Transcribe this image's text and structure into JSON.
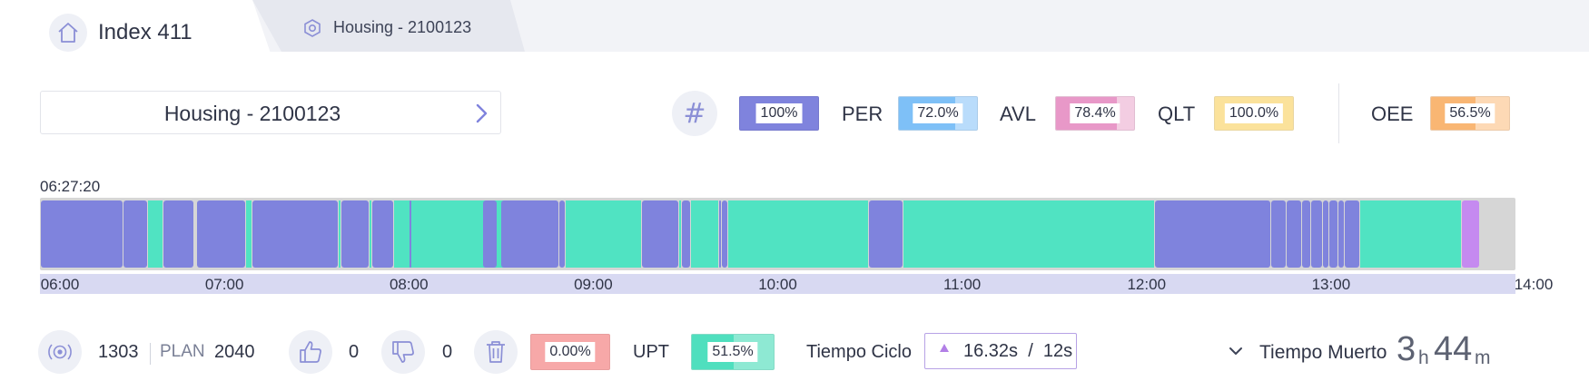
{
  "tabs": {
    "active_title": "Index 411",
    "inactive_title": "Housing - 2100123"
  },
  "selector": {
    "label": "Housing - 2100123"
  },
  "kpis": {
    "overall": {
      "value": "100%",
      "fraction": 1.0
    },
    "per": {
      "label": "PER",
      "value": "72.0%",
      "fraction": 0.72
    },
    "avl": {
      "label": "AVL",
      "value": "78.4%",
      "fraction": 0.784
    },
    "qlt": {
      "label": "QLT",
      "value": "100.0%",
      "fraction": 1.0
    },
    "oee": {
      "label": "OEE",
      "value": "56.5%",
      "fraction": 0.565
    }
  },
  "timeline": {
    "start_time": "06:27:20",
    "ticks": [
      "06:00",
      "07:00",
      "08:00",
      "09:00",
      "10:00",
      "11:00",
      "12:00",
      "13:00",
      "14:00"
    ],
    "range_hours": [
      6.0,
      14.0
    ],
    "segments": [
      {
        "from": "06:00",
        "to": "06:27",
        "state": "stopped"
      },
      {
        "from": "06:27",
        "to": "06:35",
        "state": "stopped"
      },
      {
        "from": "06:35",
        "to": "06:40",
        "state": "gap"
      },
      {
        "from": "06:40",
        "to": "06:50",
        "state": "stopped"
      },
      {
        "from": "06:51",
        "to": "07:07",
        "state": "stopped"
      },
      {
        "from": "07:07",
        "to": "07:09",
        "state": "running"
      },
      {
        "from": "07:09",
        "to": "07:37",
        "state": "stopped"
      },
      {
        "from": "07:37",
        "to": "07:38",
        "state": "running"
      },
      {
        "from": "07:38",
        "to": "07:47",
        "state": "stopped"
      },
      {
        "from": "07:47",
        "to": "07:48",
        "state": "running"
      },
      {
        "from": "07:48",
        "to": "07:55",
        "state": "stopped"
      },
      {
        "from": "07:55",
        "to": "08:40",
        "state": "running"
      },
      {
        "from": "08:00",
        "to": "08:01",
        "state": "stopped"
      },
      {
        "from": "08:24",
        "to": "08:29",
        "state": "stopped"
      },
      {
        "from": "08:29",
        "to": "08:30",
        "state": "running"
      },
      {
        "from": "08:30",
        "to": "08:49",
        "state": "stopped"
      },
      {
        "from": "08:49",
        "to": "08:51",
        "state": "stopped"
      },
      {
        "from": "08:51",
        "to": "09:16",
        "state": "running"
      },
      {
        "from": "09:16",
        "to": "09:28",
        "state": "stopped"
      },
      {
        "from": "09:28",
        "to": "09:29",
        "state": "running"
      },
      {
        "from": "09:29",
        "to": "09:32",
        "state": "stopped"
      },
      {
        "from": "09:32",
        "to": "09:41",
        "state": "running"
      },
      {
        "from": "09:41",
        "to": "09:42",
        "state": "stopped"
      },
      {
        "from": "09:42",
        "to": "09:44",
        "state": "stopped"
      },
      {
        "from": "09:44",
        "to": "10:30",
        "state": "running"
      },
      {
        "from": "10:30",
        "to": "10:41",
        "state": "stopped"
      },
      {
        "from": "10:41",
        "to": "12:03",
        "state": "running"
      },
      {
        "from": "12:03",
        "to": "12:41",
        "state": "stopped"
      },
      {
        "from": "12:41",
        "to": "12:46",
        "state": "stopped"
      },
      {
        "from": "12:46",
        "to": "12:51",
        "state": "stopped"
      },
      {
        "from": "12:51",
        "to": "12:54",
        "state": "stopped"
      },
      {
        "from": "12:54",
        "to": "12:58",
        "state": "stopped"
      },
      {
        "from": "12:58",
        "to": "13:00",
        "state": "stopped"
      },
      {
        "from": "13:00",
        "to": "13:03",
        "state": "stopped"
      },
      {
        "from": "13:03",
        "to": "13:05",
        "state": "stopped"
      },
      {
        "from": "13:05",
        "to": "13:10",
        "state": "stopped"
      },
      {
        "from": "13:10",
        "to": "13:43",
        "state": "running"
      },
      {
        "from": "13:43",
        "to": "13:49",
        "state": "setup"
      }
    ],
    "colors": {
      "stopped": "#7f83dd",
      "running": "#50e3c2",
      "setup": "#c58af0",
      "gap": "#50e3c2"
    }
  },
  "bottom": {
    "count": "1303",
    "plan_label": "PLAN",
    "plan_value": "2040",
    "good_count": "0",
    "bad_count": "0",
    "scrap_value": "0.00%",
    "upt_label": "UPT",
    "upt_value": "51.5%",
    "upt_fraction": 0.515,
    "ciclo_label": "Tiempo Ciclo",
    "ciclo_actual": "16.32s",
    "ciclo_sep": "/",
    "ciclo_target": "12s",
    "muerto_label": "Tiempo Muerto",
    "muerto_hours": "3",
    "muerto_h_unit": "h",
    "muerto_minutes": "44",
    "muerto_m_unit": "m"
  },
  "icons": {
    "home": "home-icon",
    "hexagon": "hexagon-icon",
    "chevron_right": "chevron-right-icon",
    "hash": "hash-icon",
    "signal": "signal-icon",
    "thumbs_up": "thumbs-up-icon",
    "thumbs_down": "thumbs-down-icon",
    "trash": "trash-icon",
    "chevron_down": "chevron-down-icon"
  }
}
